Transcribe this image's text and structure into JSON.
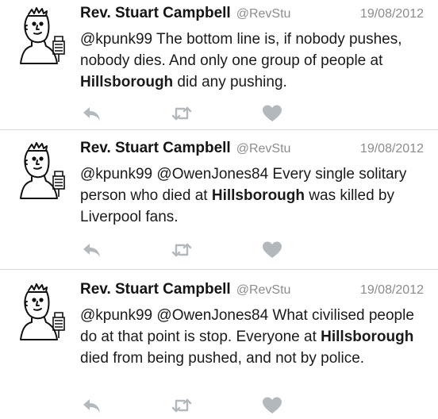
{
  "feed": {
    "tweets": [
      {
        "author": "Rev. Stuart Campbell",
        "handle": "@RevStu",
        "date": "19/08/2012",
        "text_parts": [
          {
            "t": "@kpunk99 The bottom line is, if nobody pushes, nobody dies. And only one group of people at ",
            "b": false
          },
          {
            "t": "Hillsborough",
            "b": true
          },
          {
            "t": " did any pushing.",
            "b": false
          }
        ]
      },
      {
        "author": "Rev. Stuart Campbell",
        "handle": "@RevStu",
        "date": "19/08/2012",
        "text_parts": [
          {
            "t": "@kpunk99 @OwenJones84 Every single solitary person who died at ",
            "b": false
          },
          {
            "t": "Hillsborough",
            "b": true
          },
          {
            "t": " was killed by Liverpool fans.",
            "b": false
          }
        ]
      },
      {
        "author": "Rev. Stuart Campbell",
        "handle": "@RevStu",
        "date": "19/08/2012",
        "text_parts": [
          {
            "t": "@kpunk99 @OwenJones84 What civilised people do at that point is stop. Everyone at ",
            "b": false
          },
          {
            "t": "Hillsborough",
            "b": true
          },
          {
            "t": " died from being pushed, and not by police.",
            "b": false
          }
        ]
      }
    ]
  },
  "icons": {
    "avatar": "cartoon-avatar-icon",
    "reply": "reply-icon",
    "retweet": "retweet-icon",
    "like": "heart-icon"
  },
  "colors": {
    "action_icon": "#b3b8bd",
    "muted_text": "#8c8c8c",
    "divider": "#d9d9d9"
  }
}
